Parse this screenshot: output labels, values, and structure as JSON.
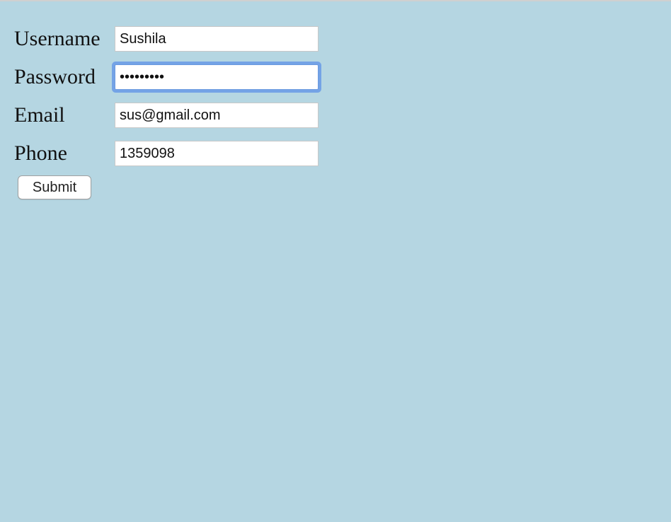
{
  "form": {
    "username": {
      "label": "Username",
      "value": "Sushila"
    },
    "password": {
      "label": "Password",
      "value": "•••••••••"
    },
    "email": {
      "label": "Email",
      "value": "sus@gmail.com"
    },
    "phone": {
      "label": "Phone",
      "value": "1359098"
    },
    "submit_label": "Submit"
  },
  "colors": {
    "page_background": "#b5d6e2",
    "focus_ring": "#74a3e6"
  }
}
